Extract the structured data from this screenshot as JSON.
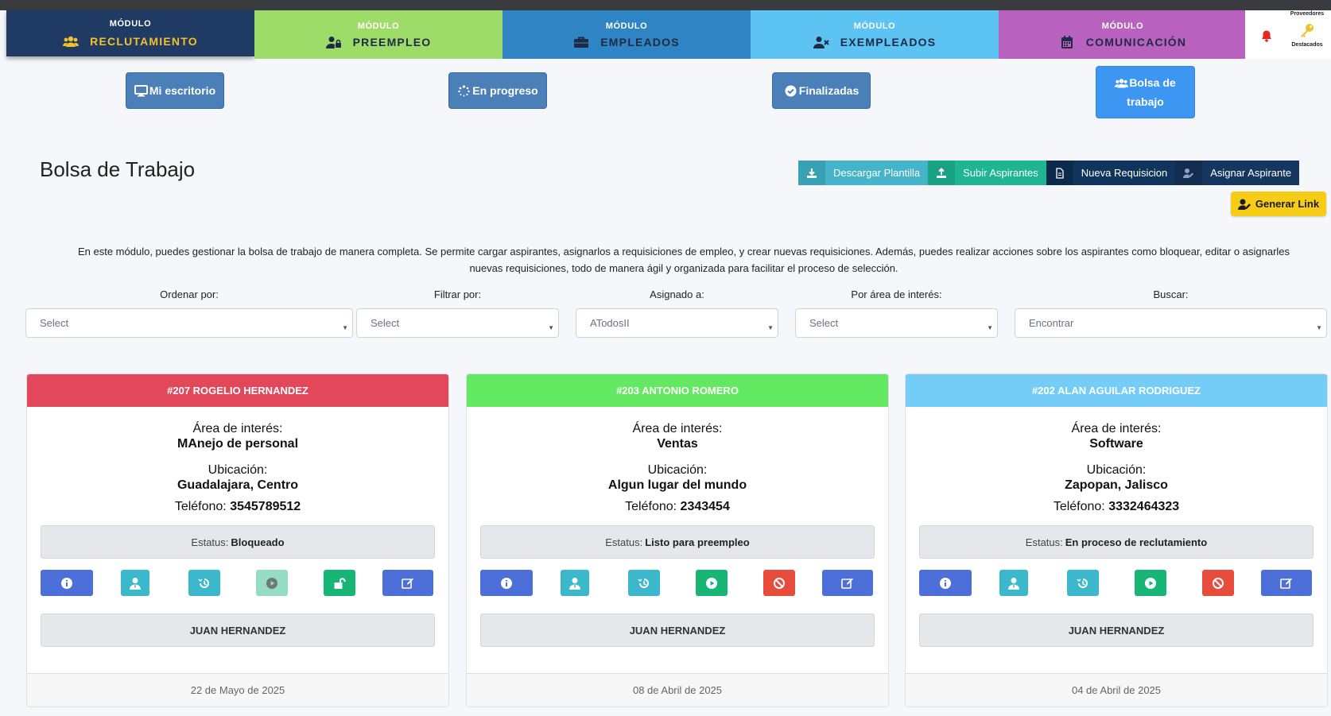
{
  "modules": [
    {
      "top": "MÓDULO",
      "name": "RECLUTAMIENTO",
      "icon": "users-icon"
    },
    {
      "top": "MÓDULO",
      "name": "PREEMPLEO",
      "icon": "user-lock-icon"
    },
    {
      "top": "MÓDULO",
      "name": "EMPLEADOS",
      "icon": "briefcase-icon"
    },
    {
      "top": "MÓDULO",
      "name": "EXEMPLEADOS",
      "icon": "user-x-icon"
    },
    {
      "top": "MÓDULO",
      "name": "COMUNICACIÓN",
      "icon": "calendar-icon"
    }
  ],
  "top_icons": {
    "proveedores": "Proveedores",
    "destacados": "Destacados",
    "bell_color": "#e8261c",
    "key_color": "#f2c12e"
  },
  "views": [
    {
      "label": "Mi escritorio",
      "icon": "monitor-icon"
    },
    {
      "label": "En progreso",
      "icon": "spinner-icon"
    },
    {
      "label": "Finalizadas",
      "icon": "check-circle-icon"
    },
    {
      "label_line1": "Bolsa de",
      "label_line2": "trabajo",
      "icon": "users-icon",
      "active": true
    }
  ],
  "page": {
    "title": "Bolsa de Trabajo",
    "description_line1": "En este módulo, puedes gestionar la bolsa de trabajo de manera completa. Se permite cargar aspirantes, asignarlos a requisiciones de empleo, y crear nuevas requisiciones. Además, puedes realizar acciones sobre los aspirantes como bloquear, editar o asignarles",
    "description_line2": "nuevas requisiciones, todo de manera ágil y organizada para facilitar el proceso de selección."
  },
  "actions": {
    "descargar": "Descargar Plantilla",
    "subir": "Subir Aspirantes",
    "nueva": "Nueva Requisicion",
    "asignar": "Asignar Aspirante",
    "generar": "Generar Link"
  },
  "filters": {
    "ordenar": {
      "label": "Ordenar por:",
      "value": "Select"
    },
    "filtrar": {
      "label": "Filtrar por:",
      "value": "Select"
    },
    "asignado": {
      "label": "Asignado a:",
      "value": "ATodosII"
    },
    "area": {
      "label": "Por área de interés:",
      "value": "Select"
    },
    "buscar": {
      "label": "Buscar:",
      "placeholder": "Encontrar"
    }
  },
  "labels": {
    "area": "Área de interés:",
    "ubicacion": "Ubicación:",
    "telefono": "Teléfono:",
    "estatus": "Estatus:"
  },
  "cards": [
    {
      "header": "#207 ROGELIO HERNANDEZ",
      "header_color": "#e2485a",
      "area": "MAnejo de personal",
      "ubicacion": "Guadalajara, Centro",
      "telefono": "3545789512",
      "estatus": "Bloqueado",
      "asignado": "JUAN HERNANDEZ",
      "fecha": "22 de Mayo de 2025",
      "blocked": true
    },
    {
      "header": "#203 ANTONIO ROMERO",
      "header_color": "#63e862",
      "area": "Ventas",
      "ubicacion": "Algun lugar del mundo",
      "telefono": "2343454",
      "estatus": "Listo para preempleo",
      "asignado": "JUAN HERNANDEZ",
      "fecha": "08 de Abril de 2025",
      "blocked": false
    },
    {
      "header": "#202 ALAN AGUILAR RODRIGUEZ",
      "header_color": "#74cdf7",
      "area": "Software",
      "ubicacion": "Zapopan, Jalisco",
      "telefono": "3332464323",
      "estatus": "En proceso de reclutamiento",
      "asignado": "JUAN HERNANDEZ",
      "fecha": "04 de Abril de 2025",
      "blocked": false
    }
  ]
}
